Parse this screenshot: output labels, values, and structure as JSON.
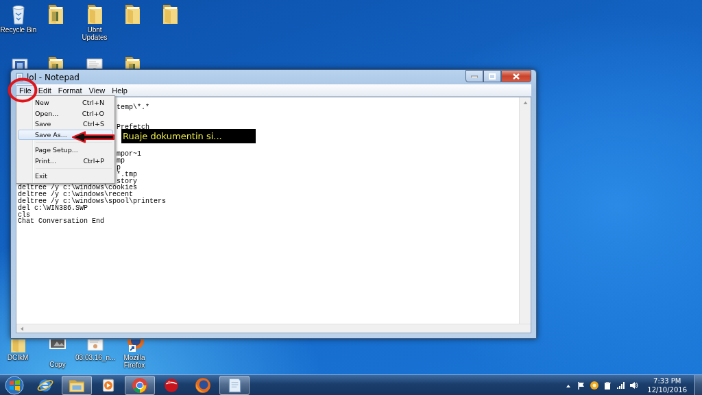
{
  "desktop_icons": [
    {
      "kind": "recycle-bin",
      "label": "Recycle Bin"
    },
    {
      "kind": "photo-folder"
    },
    {
      "kind": "folder",
      "label": "Ubnt Updates"
    },
    {
      "kind": "folder"
    },
    {
      "kind": "folder"
    },
    {
      "kind": "program"
    },
    {
      "kind": "photo-folder"
    },
    {
      "kind": "document"
    },
    {
      "kind": "photo-folder"
    },
    {
      "kind": "folder",
      "label": "DCIkM"
    },
    {
      "kind": "photo",
      "label": "Copy"
    },
    {
      "kind": "document",
      "label": "03.03.16_n..."
    },
    {
      "kind": "firefox",
      "label": "Mozilla Firefox"
    }
  ],
  "window": {
    "title": "lol - Notepad",
    "menu": [
      {
        "label": "File",
        "selected": true
      },
      {
        "label": "Edit",
        "selected": false
      },
      {
        "label": "Format",
        "selected": false
      },
      {
        "label": "View",
        "selected": false
      },
      {
        "label": "Help",
        "selected": false
      }
    ],
    "file_menu": [
      {
        "kind": "item",
        "label": "New",
        "shortcut": "Ctrl+N",
        "selected": false
      },
      {
        "kind": "item",
        "label": "Open...",
        "shortcut": "Ctrl+O",
        "selected": false
      },
      {
        "kind": "item",
        "label": "Save",
        "shortcut": "Ctrl+S",
        "selected": false
      },
      {
        "kind": "item",
        "label": "Save As...",
        "selected": true
      },
      {
        "kind": "separator"
      },
      {
        "kind": "item",
        "label": "Page Setup...",
        "selected": false
      },
      {
        "kind": "item",
        "label": "Print...",
        "shortcut": "Ctrl+P",
        "selected": false
      },
      {
        "kind": "separator"
      },
      {
        "kind": "item",
        "label": "Exit",
        "selected": false
      }
    ],
    "lines": [
      {
        "kind": "hidden"
      },
      {
        "kind": "partial",
        "text": "temp\\*.*"
      },
      {
        "kind": "hidden"
      },
      {
        "kind": "hidden"
      },
      {
        "kind": "partial",
        "text": "Prefetch"
      },
      {
        "kind": "hidden"
      },
      {
        "kind": "hidden"
      },
      {
        "kind": "hidden"
      },
      {
        "kind": "partial",
        "text": "mpor~1"
      },
      {
        "kind": "partial",
        "text": "mp"
      },
      {
        "kind": "partial",
        "text": "p"
      },
      {
        "kind": "partial",
        "text": "*.tmp"
      },
      {
        "kind": "partial",
        "text": "story"
      },
      {
        "kind": "full",
        "text": "deltree /y c:\\windows\\cookies"
      },
      {
        "kind": "full",
        "text": "deltree /y c:\\windows\\recent"
      },
      {
        "kind": "full",
        "text": "deltree /y c:\\windows\\spool\\printers"
      },
      {
        "kind": "full",
        "text": "del c:\\WIN386.SWP"
      },
      {
        "kind": "full",
        "text": "cls"
      },
      {
        "kind": "full",
        "text": "Chat Conversation End"
      }
    ]
  },
  "annotation": {
    "callout": "Ruaje dokumentin si..."
  },
  "taskbar": {
    "apps": [
      {
        "kind": "ie",
        "active": false
      },
      {
        "kind": "explorer",
        "active": true
      },
      {
        "kind": "media",
        "active": false
      },
      {
        "kind": "chrome",
        "active": true
      },
      {
        "kind": "red-app",
        "active": false
      },
      {
        "kind": "firefox",
        "active": false
      },
      {
        "kind": "notepad",
        "active": true
      }
    ],
    "time": "7:33 PM",
    "date": "12/10/2016"
  }
}
